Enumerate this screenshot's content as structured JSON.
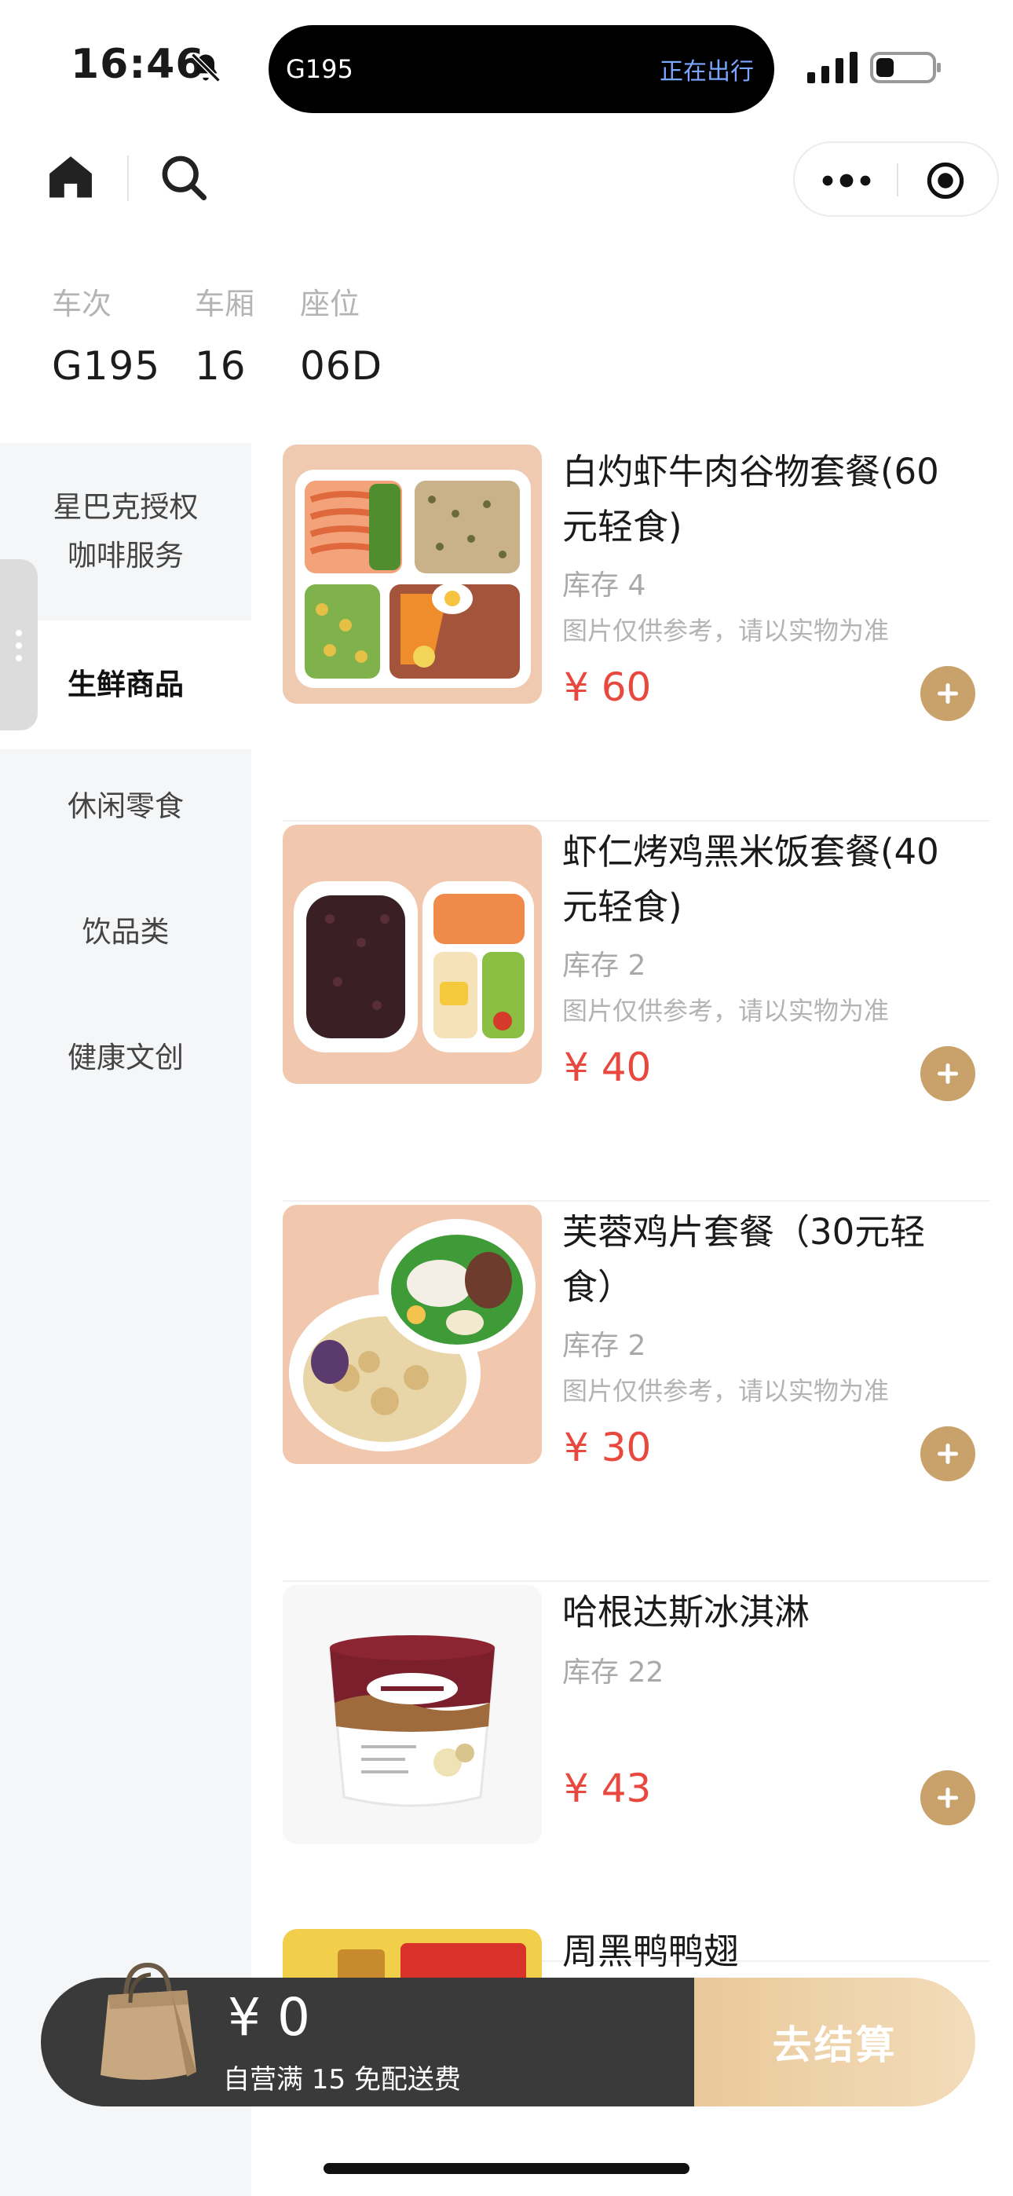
{
  "status_bar": {
    "time": "16:46",
    "island_train": "G195",
    "island_status": "正在出行"
  },
  "train_info": {
    "labels": {
      "train": "车次",
      "carriage": "车厢",
      "seat": "座位"
    },
    "values": {
      "train": "G195",
      "carriage": "16",
      "seat": "06D"
    }
  },
  "sidebar": {
    "items": [
      {
        "label_line1": "星巴克授权",
        "label_line2": "咖啡服务"
      },
      {
        "label": "生鲜商品",
        "active": true
      },
      {
        "label": "休闲零食"
      },
      {
        "label": "饮品类"
      },
      {
        "label": "健康文创"
      }
    ]
  },
  "products": [
    {
      "name": "白灼虾牛肉谷物套餐(60元轻食)",
      "stock": "库存 4",
      "note": "图片仅供参考，请以实物为准",
      "price": "¥ 60"
    },
    {
      "name": "虾仁烤鸡黑米饭套餐(40元轻食)",
      "stock": "库存 2",
      "note": "图片仅供参考，请以实物为准",
      "price": "¥ 40"
    },
    {
      "name": "芙蓉鸡片套餐（30元轻食）",
      "stock": "库存 2",
      "note": "图片仅供参考，请以实物为准",
      "price": "¥ 30"
    },
    {
      "name": "哈根达斯冰淇淋",
      "stock": "库存 22",
      "price": "¥ 43"
    },
    {
      "name": "周黑鸭鸭翅"
    }
  ],
  "cart": {
    "amount": "¥ 0",
    "note": "自营满 15 免配送费",
    "checkout_label": "去结算"
  },
  "colors": {
    "accent": "#c9a16b",
    "price": "#e8483e",
    "island_status": "#7aa7ff"
  }
}
